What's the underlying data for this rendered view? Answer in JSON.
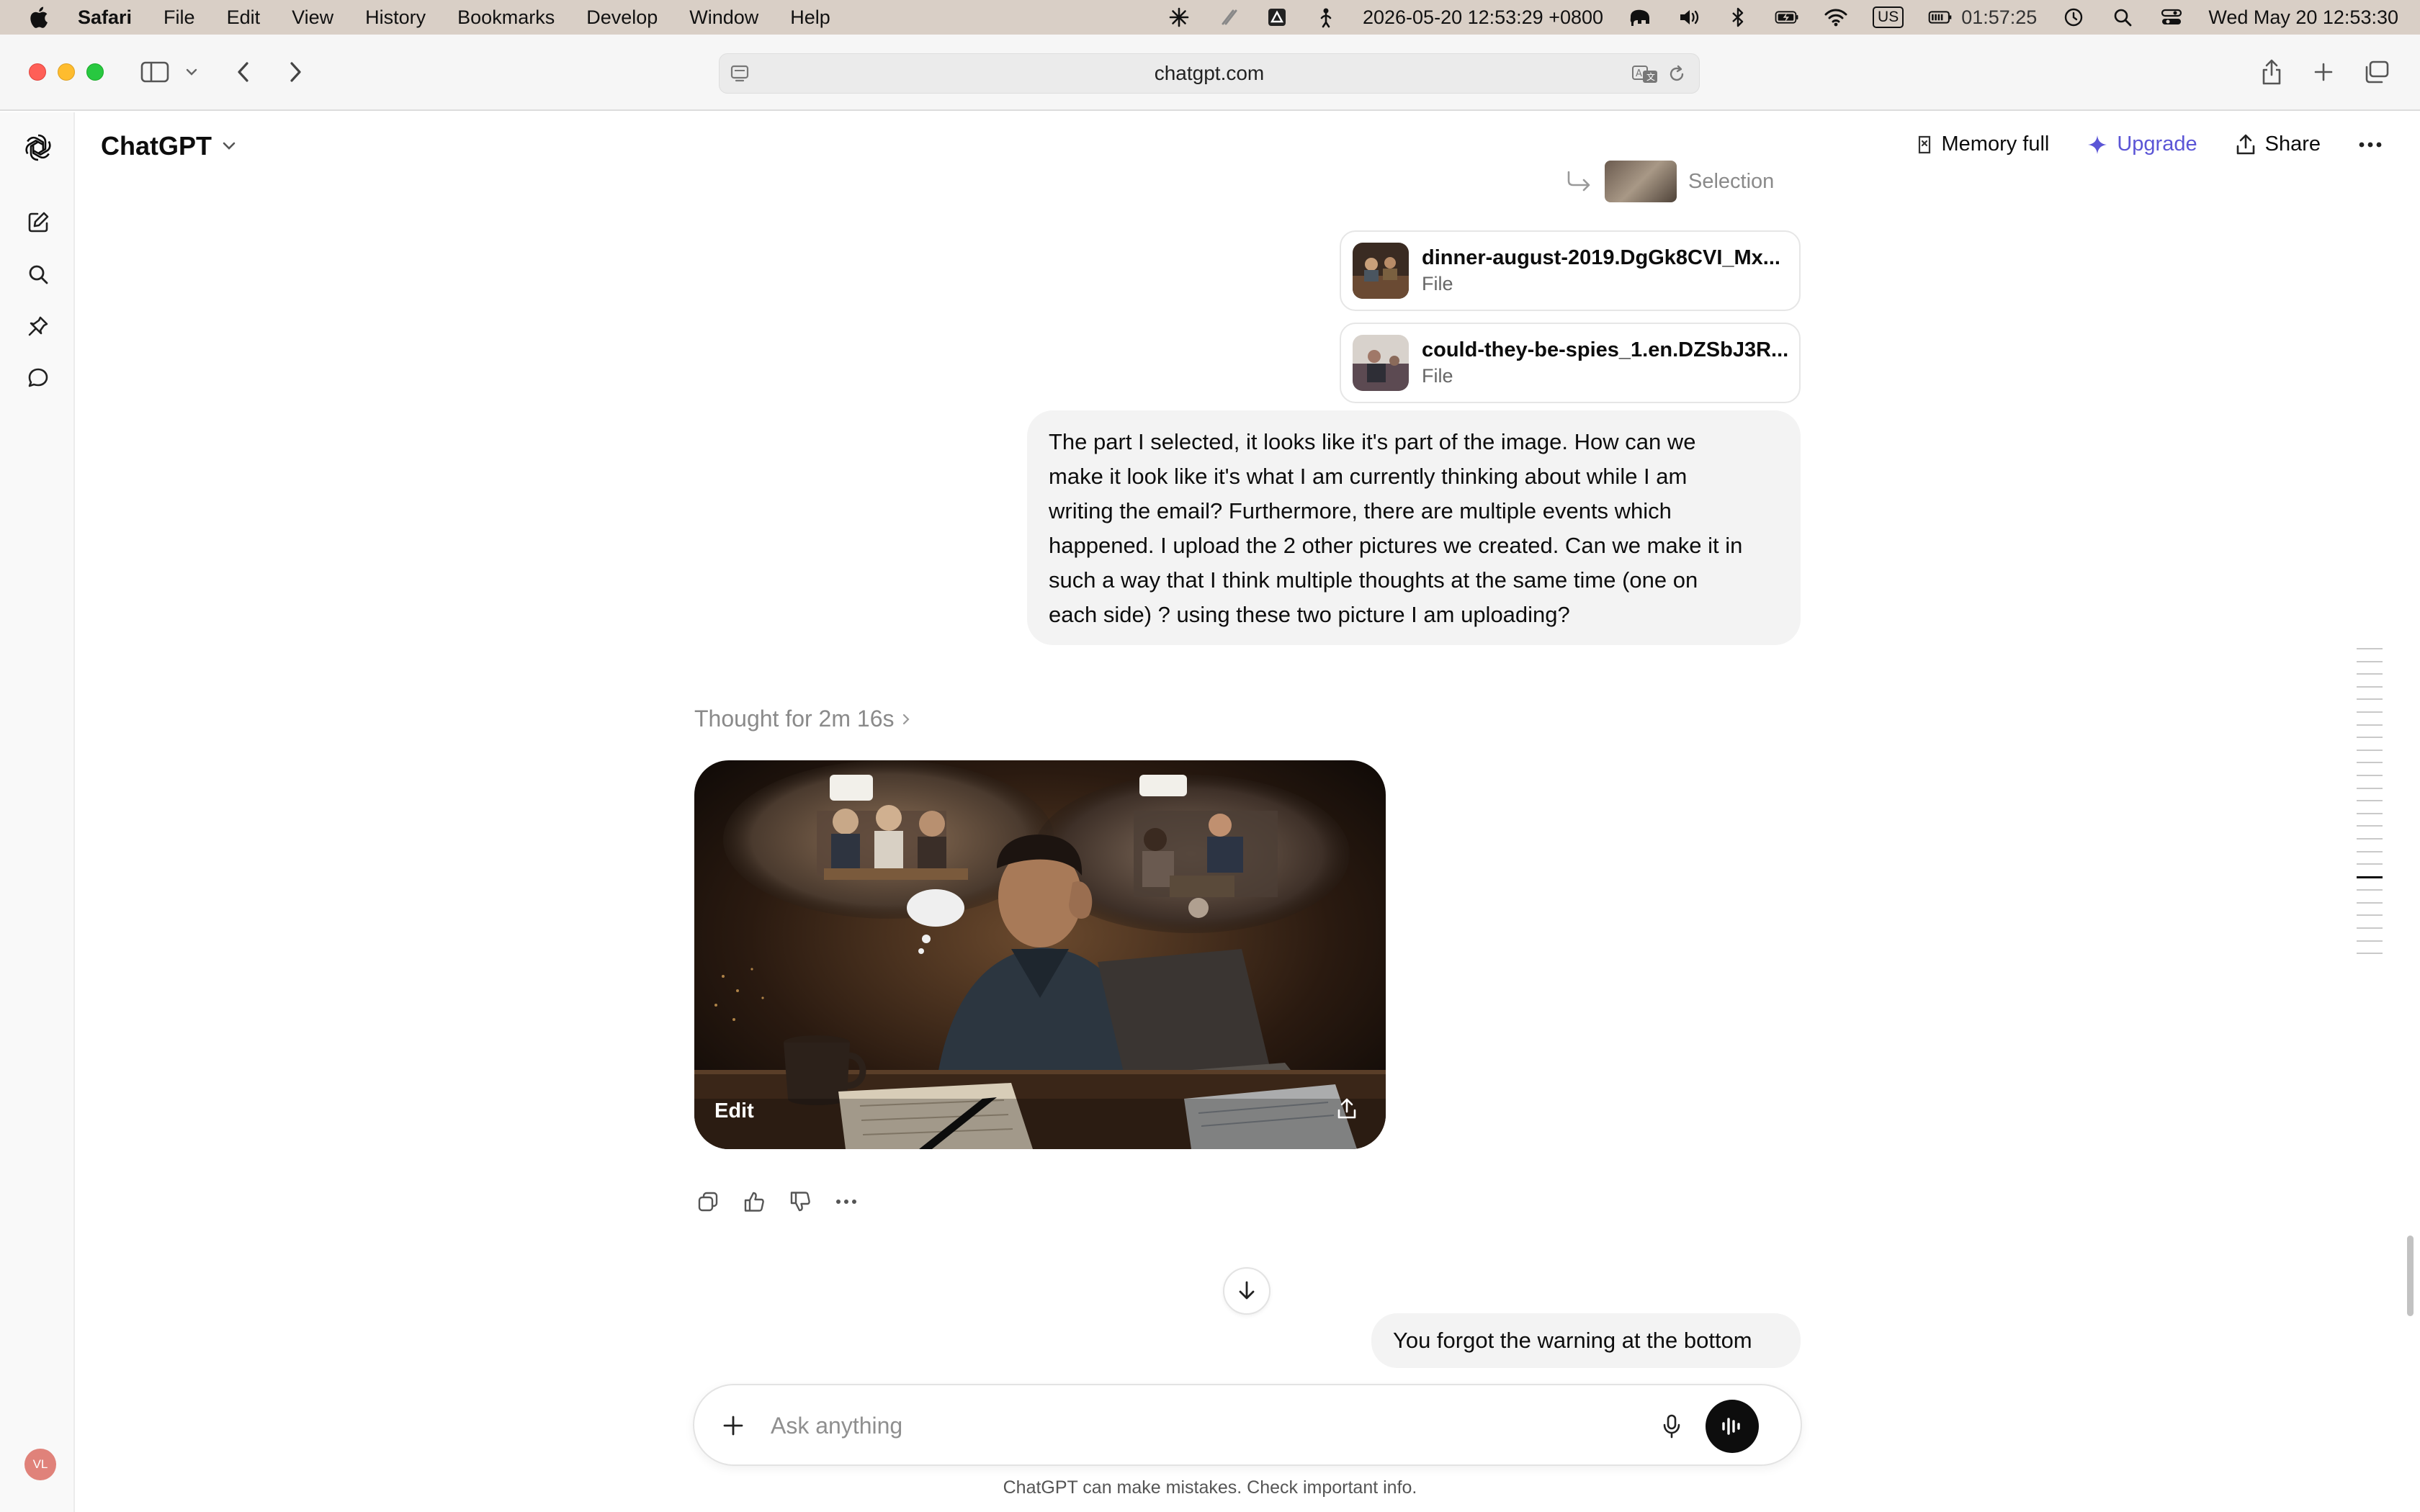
{
  "menubar": {
    "app_name": "Safari",
    "menus": [
      "File",
      "Edit",
      "View",
      "History",
      "Bookmarks",
      "Develop",
      "Window",
      "Help"
    ],
    "datetime_stamp": "2026-05-20 12:53:29 +0800",
    "keyboard_layout": "US",
    "battery_time": "01:57:25",
    "clock": "Wed May 20  12:53:30"
  },
  "browser": {
    "url": "chatgpt.com"
  },
  "header": {
    "model_name": "ChatGPT",
    "memory_label": "Memory full",
    "upgrade_label": "Upgrade",
    "share_label": "Share"
  },
  "conversation": {
    "selection_label": "Selection",
    "attachments": [
      {
        "name": "dinner-august-2019.DgGk8CVI_Mx...",
        "type": "File"
      },
      {
        "name": "could-they-be-spies_1.en.DZSbJ3R...",
        "type": "File"
      }
    ],
    "user_message_1_lines": [
      "The part I selected, it looks like it's part of the image. How can we",
      "make it look like it's what I am currently thinking about while I am",
      "writing the email? Furthermore, there are multiple events which",
      "happened. I upload the 2 other pictures we created. Can we make it in",
      "such a way that I think multiple thoughts at the same time (one on",
      "each side) ? using these two picture I am uploading?"
    ],
    "thought_label": "Thought for 2m 16s",
    "image_edit_label": "Edit",
    "user_message_2": "You forgot the warning at the bottom"
  },
  "composer": {
    "placeholder": "Ask anything"
  },
  "user": {
    "initials": "VL"
  },
  "disclaimer": "ChatGPT can make mistakes. Check important info.",
  "colors": {
    "menubar_bg": "#d9cfc6",
    "accent_upgrade": "#5b55d6",
    "user_bubble_bg": "#f3f3f3",
    "avatar_bg": "#e0827a"
  }
}
